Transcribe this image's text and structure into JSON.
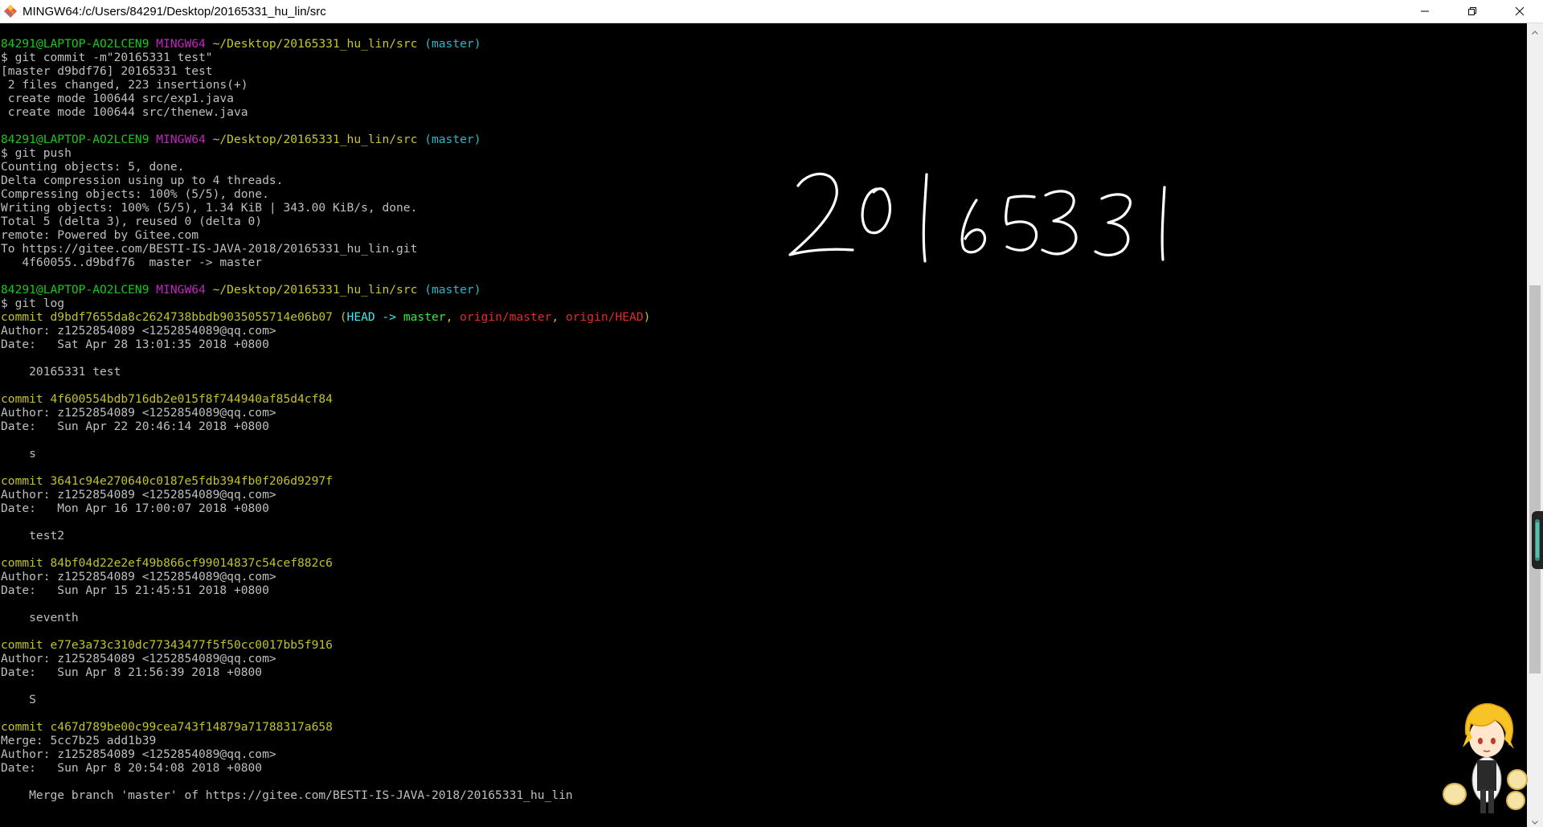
{
  "window": {
    "title": "MINGW64:/c/Users/84291/Desktop/20165331_hu_lin/src",
    "controls": {
      "minimize_icon": "minimize-icon",
      "restore_icon": "restore-icon",
      "close_icon": "close-icon"
    }
  },
  "terminal": {
    "background": "#000000",
    "lines": [
      [
        {
          "t": "84291@LAPTOP-AO2LCEN9 ",
          "c": "green"
        },
        {
          "t": "MINGW64 ",
          "c": "magenta"
        },
        {
          "t": "~/Desktop/20165331_hu_lin/src ",
          "c": "yellow"
        },
        {
          "t": "(master)",
          "c": "cyan"
        }
      ],
      [
        {
          "t": "$ git commit -m\"20165331 test\""
        }
      ],
      [
        {
          "t": "[master d9bdf76] 20165331 test"
        }
      ],
      [
        {
          "t": " 2 files changed, 223 insertions(+)"
        }
      ],
      [
        {
          "t": " create mode 100644 src/exp1.java"
        }
      ],
      [
        {
          "t": " create mode 100644 src/thenew.java"
        }
      ],
      [
        {
          "t": ""
        }
      ],
      [
        {
          "t": "84291@LAPTOP-AO2LCEN9 ",
          "c": "green"
        },
        {
          "t": "MINGW64 ",
          "c": "magenta"
        },
        {
          "t": "~/Desktop/20165331_hu_lin/src ",
          "c": "yellow"
        },
        {
          "t": "(master)",
          "c": "cyan"
        }
      ],
      [
        {
          "t": "$ git push"
        }
      ],
      [
        {
          "t": "Counting objects: 5, done."
        }
      ],
      [
        {
          "t": "Delta compression using up to 4 threads."
        }
      ],
      [
        {
          "t": "Compressing objects: 100% (5/5), done."
        }
      ],
      [
        {
          "t": "Writing objects: 100% (5/5), 1.34 KiB | 343.00 KiB/s, done."
        }
      ],
      [
        {
          "t": "Total 5 (delta 3), reused 0 (delta 0)"
        }
      ],
      [
        {
          "t": "remote: Powered by Gitee.com"
        }
      ],
      [
        {
          "t": "To https://gitee.com/BESTI-IS-JAVA-2018/20165331_hu_lin.git"
        }
      ],
      [
        {
          "t": "   4f60055..d9bdf76  master -> master"
        }
      ],
      [
        {
          "t": ""
        }
      ],
      [
        {
          "t": "84291@LAPTOP-AO2LCEN9 ",
          "c": "green"
        },
        {
          "t": "MINGW64 ",
          "c": "magenta"
        },
        {
          "t": "~/Desktop/20165331_hu_lin/src ",
          "c": "yellow"
        },
        {
          "t": "(master)",
          "c": "cyan"
        }
      ],
      [
        {
          "t": "$ git log"
        }
      ],
      [
        {
          "t": "commit d9bdf7655da8c2624738bbdb9035055714e06b07 ",
          "c": "commit"
        },
        {
          "t": "(",
          "c": "commit"
        },
        {
          "t": "HEAD -> ",
          "c": "bcyan"
        },
        {
          "t": "master",
          "c": "bgreen"
        },
        {
          "t": ", ",
          "c": "commit"
        },
        {
          "t": "origin/master",
          "c": "red"
        },
        {
          "t": ", ",
          "c": "commit"
        },
        {
          "t": "origin/HEAD",
          "c": "red"
        },
        {
          "t": ")",
          "c": "commit"
        }
      ],
      [
        {
          "t": "Author: z1252854089 <1252854089@qq.com>"
        }
      ],
      [
        {
          "t": "Date:   Sat Apr 28 13:01:35 2018 +0800"
        }
      ],
      [
        {
          "t": ""
        }
      ],
      [
        {
          "t": "    20165331 test"
        }
      ],
      [
        {
          "t": ""
        }
      ],
      [
        {
          "t": "commit 4f600554bdb716db2e015f8f744940af85d4cf84",
          "c": "commit"
        }
      ],
      [
        {
          "t": "Author: z1252854089 <1252854089@qq.com>"
        }
      ],
      [
        {
          "t": "Date:   Sun Apr 22 20:46:14 2018 +0800"
        }
      ],
      [
        {
          "t": ""
        }
      ],
      [
        {
          "t": "    s"
        }
      ],
      [
        {
          "t": ""
        }
      ],
      [
        {
          "t": "commit 3641c94e270640c0187e5fdb394fb0f206d9297f",
          "c": "commit"
        }
      ],
      [
        {
          "t": "Author: z1252854089 <1252854089@qq.com>"
        }
      ],
      [
        {
          "t": "Date:   Mon Apr 16 17:00:07 2018 +0800"
        }
      ],
      [
        {
          "t": ""
        }
      ],
      [
        {
          "t": "    test2"
        }
      ],
      [
        {
          "t": ""
        }
      ],
      [
        {
          "t": "commit 84bf04d22e2ef49b866cf99014837c54cef882c6",
          "c": "commit"
        }
      ],
      [
        {
          "t": "Author: z1252854089 <1252854089@qq.com>"
        }
      ],
      [
        {
          "t": "Date:   Sun Apr 15 21:45:51 2018 +0800"
        }
      ],
      [
        {
          "t": ""
        }
      ],
      [
        {
          "t": "    seventh"
        }
      ],
      [
        {
          "t": ""
        }
      ],
      [
        {
          "t": "commit e77e3a73c310dc77343477f5f50cc0017bb5f916",
          "c": "commit"
        }
      ],
      [
        {
          "t": "Author: z1252854089 <1252854089@qq.com>"
        }
      ],
      [
        {
          "t": "Date:   Sun Apr 8 21:56:39 2018 +0800"
        }
      ],
      [
        {
          "t": ""
        }
      ],
      [
        {
          "t": "    S"
        }
      ],
      [
        {
          "t": ""
        }
      ],
      [
        {
          "t": "commit c467d789be00c99cea743f14879a71788317a658",
          "c": "commit"
        }
      ],
      [
        {
          "t": "Merge: 5cc7b25 add1b39"
        }
      ],
      [
        {
          "t": "Author: z1252854089 <1252854089@qq.com>"
        }
      ],
      [
        {
          "t": "Date:   Sun Apr 8 20:54:08 2018 +0800"
        }
      ],
      [
        {
          "t": ""
        }
      ],
      [
        {
          "t": "    Merge branch 'master' of https://gitee.com/BESTI-IS-JAVA-2018/20165331_hu_lin"
        }
      ]
    ]
  },
  "overlay": {
    "handwriting_text": "20165331",
    "mascot_icon": "anime-character-icon"
  },
  "colors": {
    "green": "#1cc71c",
    "magenta": "#c026c0",
    "yellow": "#c7c72a",
    "cyan": "#2ab7c7",
    "commit": "#c2c22a",
    "red": "#e02c2c"
  }
}
